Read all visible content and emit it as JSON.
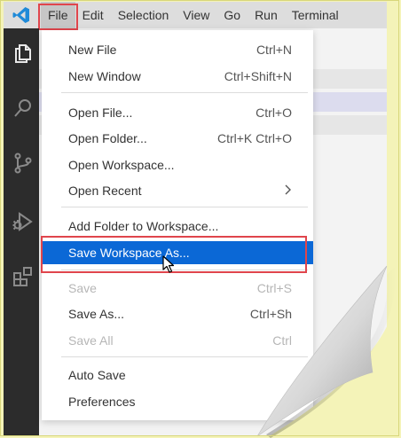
{
  "menubar": {
    "items": [
      "File",
      "Edit",
      "Selection",
      "View",
      "Go",
      "Run",
      "Terminal"
    ]
  },
  "activitybar": {
    "icons": [
      "explorer-icon",
      "search-icon",
      "source-control-icon",
      "run-debug-icon",
      "extensions-icon"
    ]
  },
  "file_menu": {
    "new_file": {
      "label": "New File",
      "shortcut": "Ctrl+N"
    },
    "new_window": {
      "label": "New Window",
      "shortcut": "Ctrl+Shift+N"
    },
    "open_file": {
      "label": "Open File...",
      "shortcut": "Ctrl+O"
    },
    "open_folder": {
      "label": "Open Folder...",
      "shortcut": "Ctrl+K Ctrl+O"
    },
    "open_workspace": {
      "label": "Open Workspace..."
    },
    "open_recent": {
      "label": "Open Recent"
    },
    "add_folder": {
      "label": "Add Folder to Workspace..."
    },
    "save_workspace_as": {
      "label": "Save Workspace As..."
    },
    "save": {
      "label": "Save",
      "shortcut": "Ctrl+S"
    },
    "save_as": {
      "label": "Save As...",
      "shortcut": "Ctrl+Sh"
    },
    "save_all": {
      "label": "Save All",
      "shortcut": "Ctrl"
    },
    "auto_save": {
      "label": "Auto Save"
    },
    "preferences": {
      "label": "Preferences"
    }
  },
  "colors": {
    "accent": "#0b68d6",
    "highlight_box": "#e0454c",
    "activity_bar": "#2c2c2c",
    "background": "#f4f3b8"
  }
}
